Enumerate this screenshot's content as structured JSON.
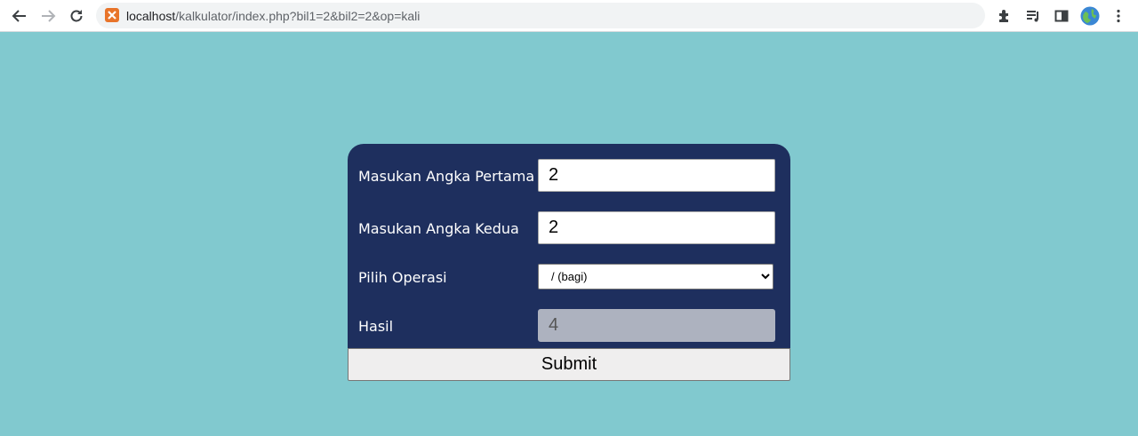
{
  "browser": {
    "url_host": "localhost",
    "url_rest": "/kalkulator/index.php?bil1=2&bil2=2&op=kali"
  },
  "form": {
    "label_first": "Masukan Angka Pertama",
    "value_first": "2",
    "label_second": "Masukan Angka Kedua",
    "value_second": "2",
    "label_operation": "Pilih Operasi",
    "operation_selected": "/ (bagi)",
    "label_result": "Hasil",
    "value_result": "4",
    "submit_label": "Submit"
  },
  "colors": {
    "page_bg": "#81c9cf",
    "card_bg": "#1e2f5e",
    "result_bg": "#adb2bf",
    "favicon": "#e8742a"
  },
  "icons": [
    "back-icon",
    "forward-icon",
    "reload-icon",
    "xampp-favicon",
    "extensions-icon",
    "reading-list-icon",
    "side-panel-icon",
    "profile-avatar",
    "menu-icon"
  ]
}
